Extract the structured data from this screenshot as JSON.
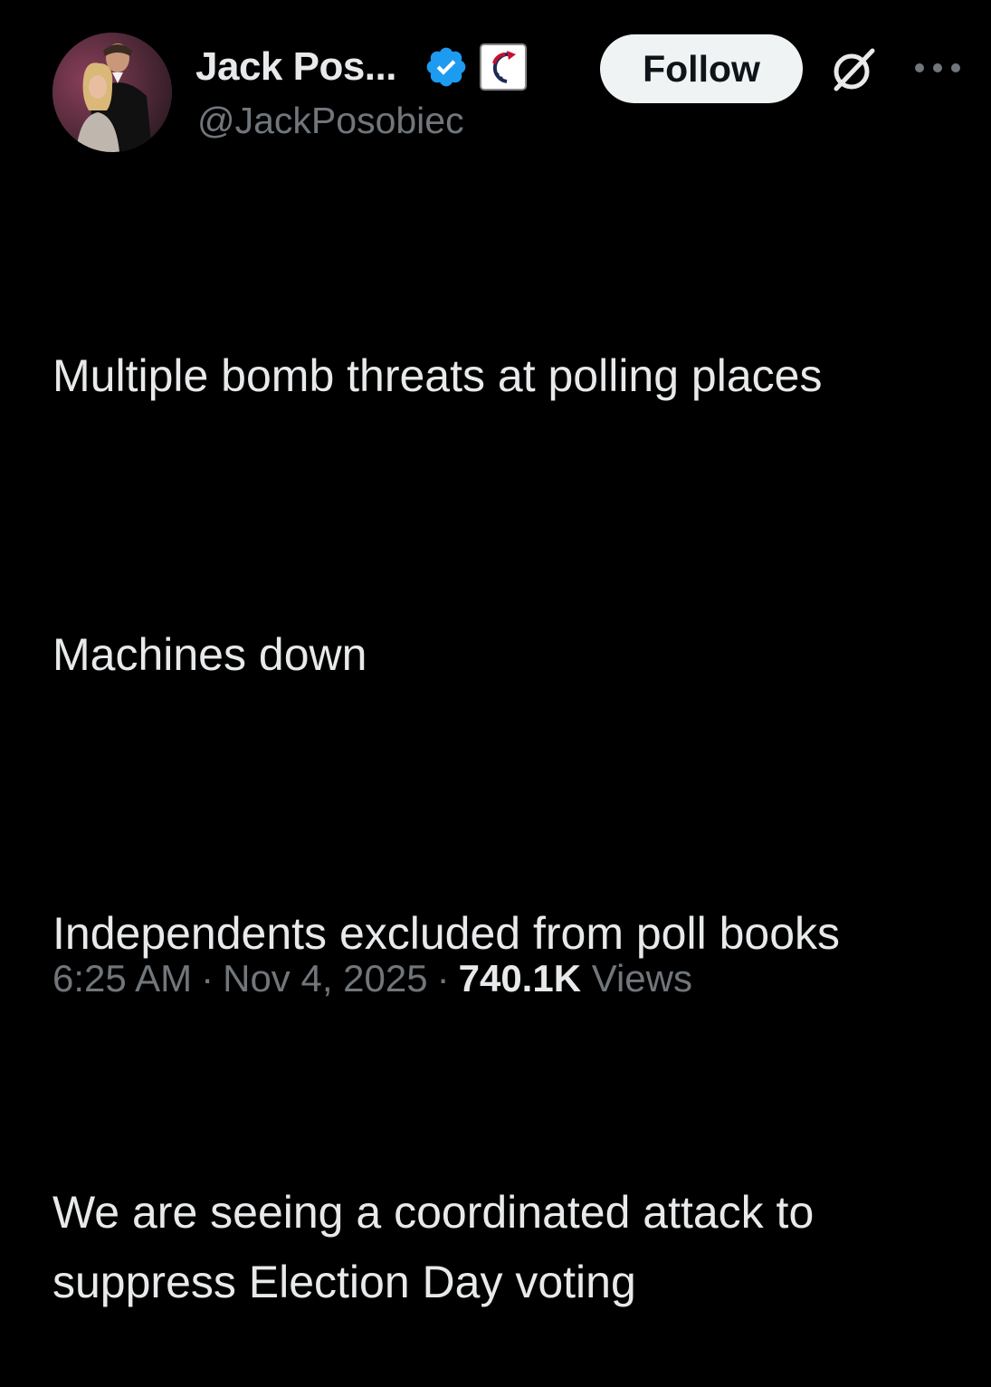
{
  "author": {
    "display_name": "Jack Pos...",
    "handle": "@JackPosobiec",
    "verified_badge_color": "#1d9bf0"
  },
  "follow_button": {
    "label": "Follow"
  },
  "icons": {
    "verified": "verified-badge-icon",
    "affiliation": "affiliation-badge-icon",
    "grok": "grok-icon",
    "more": "more-options-icon"
  },
  "tweet": {
    "paragraphs": [
      "Multiple bomb threats at polling places",
      "Machines down",
      "Independents excluded from poll books",
      "We are seeing a coordinated attack to suppress Election Day voting"
    ]
  },
  "meta": {
    "time": "6:25 AM",
    "separator": "·",
    "date": "Nov 4, 2025",
    "views_count": "740.1K",
    "views_label": "Views"
  },
  "colors": {
    "background": "#000000",
    "text": "#e7e9ea",
    "secondary_text": "#71767b",
    "follow_bg": "#eff3f4",
    "follow_text": "#0f1419"
  }
}
